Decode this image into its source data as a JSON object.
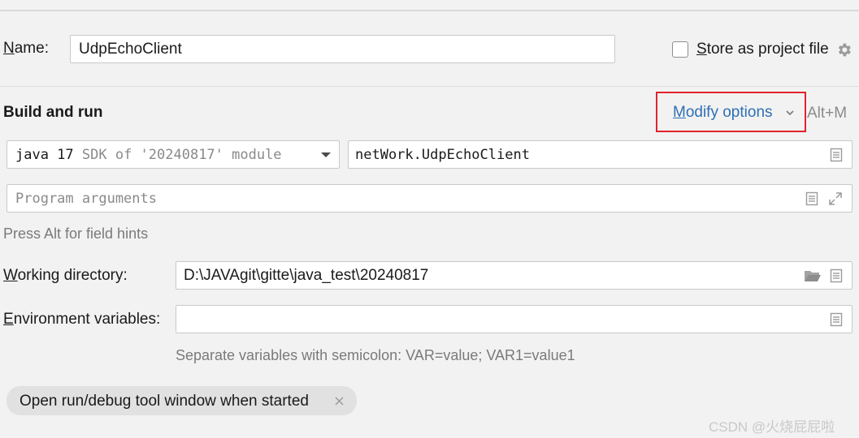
{
  "name_row": {
    "label_underlined": "N",
    "label_rest": "ame:",
    "value": "UdpEchoClient",
    "store_label_underlined": "S",
    "store_label_rest": "tore as project file",
    "store_checked": false
  },
  "section": {
    "title": "Build and run",
    "modify_underlined": "M",
    "modify_rest": "odify options",
    "shortcut": "Alt+M"
  },
  "sdk": {
    "version": "java 17",
    "description": "SDK of '20240817' module"
  },
  "main_class": {
    "value": "netWork.UdpEchoClient"
  },
  "program_args": {
    "placeholder": "Program arguments"
  },
  "field_hint": "Press Alt for field hints",
  "working_dir": {
    "label_underlined": "W",
    "label_rest": "orking directory:",
    "value": "D:\\JAVAgit\\gitte\\java_test\\20240817"
  },
  "env_vars": {
    "label_underlined": "E",
    "label_rest": "nvironment variables:",
    "value": "",
    "hint": "Separate variables with semicolon: VAR=value; VAR1=value1"
  },
  "chip": {
    "label": "Open run/debug tool window when started"
  },
  "watermark": "CSDN @火烧屁屁啦",
  "colors": {
    "accent_link": "#2f6fb5",
    "highlight_box": "#e0232b",
    "background": "#f2f2f2"
  },
  "icons": [
    "settings-gear-icon",
    "chevron-down-icon",
    "document-icon",
    "expand-icon",
    "folder-icon",
    "close-icon"
  ]
}
